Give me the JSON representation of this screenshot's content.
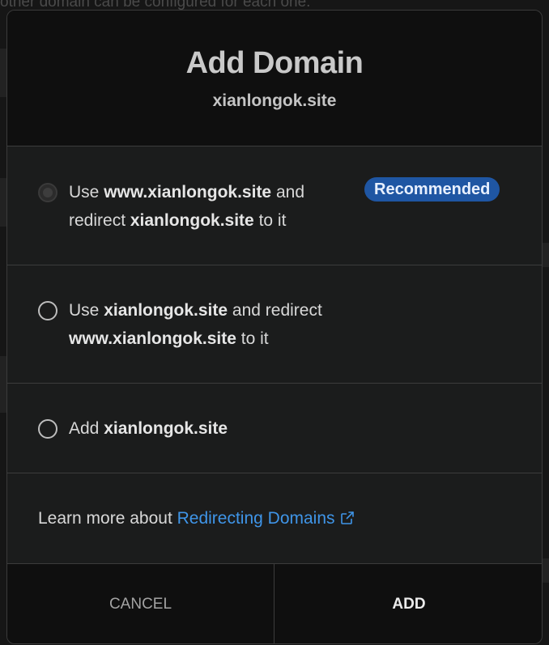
{
  "background": {
    "text": "other domain can be configured for each one."
  },
  "dialog": {
    "title": "Add Domain",
    "domain": "xianlongok.site",
    "options": [
      {
        "parts": [
          "Use ",
          "www.xianlongok.site",
          " and"
        ],
        "parts2": [
          "redirect ",
          "xianlongok.site",
          " to it"
        ],
        "badge": "Recommended",
        "selected": false,
        "disabled": true
      },
      {
        "parts": [
          "Use ",
          "xianlongok.site",
          " and redirect"
        ],
        "parts2": [
          "",
          "www.xianlongok.site",
          " to it"
        ],
        "selected": false,
        "disabled": false
      },
      {
        "parts": [
          "Add ",
          "xianlongok.site",
          ""
        ],
        "selected": false,
        "disabled": false
      }
    ],
    "learn_more": {
      "prefix": "Learn more about ",
      "link_text": "Redirecting Domains"
    },
    "buttons": {
      "cancel": "CANCEL",
      "add": "ADD"
    }
  },
  "colors": {
    "accent_link": "#3f95e8",
    "badge_bg": "#1f56a3"
  },
  "icons": {
    "external_link": "external-link-icon"
  }
}
